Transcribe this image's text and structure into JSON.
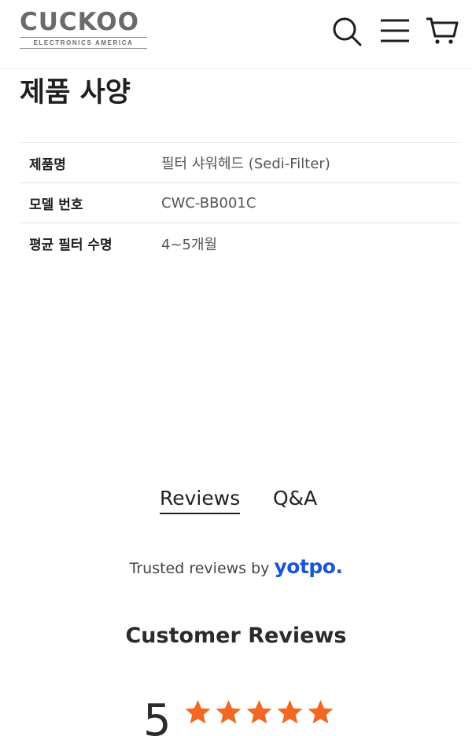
{
  "header": {
    "logo": {
      "brand": "CUCKOO",
      "subtitle": "ELECTRONICS AMERICA"
    },
    "icons": [
      "search-icon",
      "menu-icon",
      "cart-icon"
    ]
  },
  "specs": {
    "title": "제품 사양",
    "rows": [
      {
        "label": "제품명",
        "value": "필터 샤워헤드 (Sedi-Filter)"
      },
      {
        "label": "모델 번호",
        "value": "CWC-BB001C"
      },
      {
        "label": "평균 필터 수명",
        "value": "4~5개월"
      }
    ]
  },
  "reviews": {
    "tabs": [
      {
        "label": "Reviews",
        "active": true
      },
      {
        "label": "Q&A",
        "active": false
      }
    ],
    "trusted_prefix": "Trusted reviews by",
    "trusted_brand": "yotpo.",
    "customer_title": "Customer Reviews",
    "rating": "5",
    "stars": 5,
    "star_color": "#f26722",
    "brand_color": "#1a55d6"
  }
}
